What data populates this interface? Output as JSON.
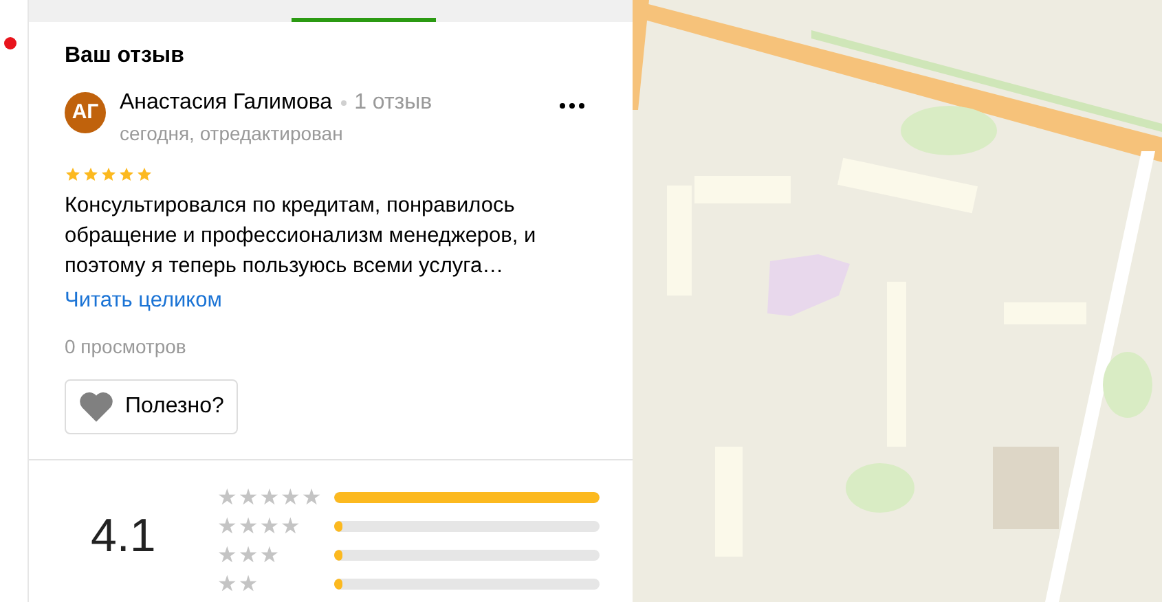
{
  "heading": "Ваш отзыв",
  "review": {
    "initials": "АГ",
    "author": "Анастасия Галимова",
    "reviews_count": "1 отзыв",
    "date": "сегодня, отредактирован",
    "stars": 5,
    "text": "Консультировался по кредитам, понравилось обращение и профессионализм менеджеров, и поэтому я теперь пользуюсь всеми услуга…",
    "read_more": "Читать целиком",
    "views": "0 просмотров",
    "helpful_button": "Полезно?"
  },
  "rating": {
    "score": "4.1",
    "rows": [
      {
        "label": "★★★★★",
        "level": 1
      },
      {
        "label": "★★★★",
        "level": 0.03
      },
      {
        "label": "★★★",
        "level": 0.03
      },
      {
        "label": "★★",
        "level": 0.03
      }
    ]
  }
}
